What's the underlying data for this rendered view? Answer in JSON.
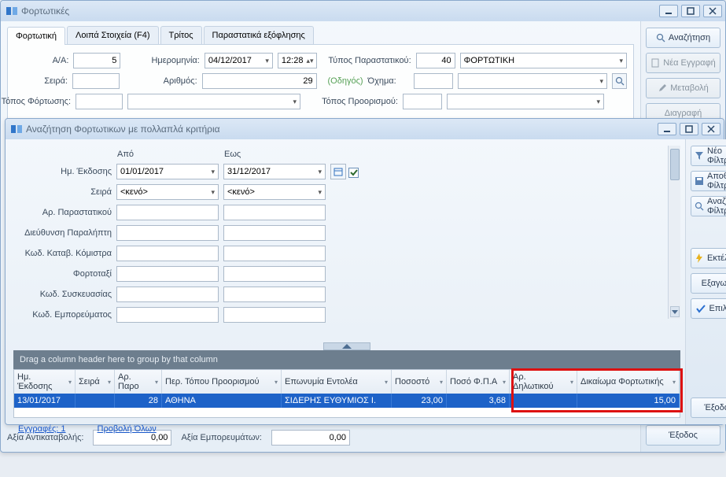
{
  "mainWindow": {
    "title": "Φορτωτικές",
    "tabs": [
      "Φορτωτική",
      "Λοιπά Στοιχεία (F4)",
      "Τρίτος",
      "Παραστατικά εξόφλησης"
    ],
    "form": {
      "aa_label": "A/A:",
      "aa_value": "5",
      "date_label": "Ημερομηνία:",
      "date_value": "04/12/2017",
      "time_value": "12:28",
      "doc_type_label": "Τύπος Παραστατικού:",
      "doc_type_code": "40",
      "doc_type_name": "ΦΟΡΤΩΤΙΚΗ",
      "seira_label": "Σειρά:",
      "seira_value": "",
      "arithmos_label": "Αριθμός:",
      "arithmos_value": "29",
      "odigos_label": "(Οδηγός)",
      "ochima_label": "Όχημα:",
      "ochima_value": "",
      "topos_fort_label": "Τόπος Φόρτωσης:",
      "topos_fort_value": "",
      "topos_proor_label": "Τόπος Προορισμού:",
      "topos_proor_value": ""
    },
    "footer": {
      "antikat_label": "Αξία Αντικαταβολής:",
      "antikat_value": "0,00",
      "emporev_label": "Αξία Εμπορευμάτων:",
      "emporev_value": "0,00"
    },
    "sidebar": {
      "search": "Αναζήτηση",
      "new": "Νέα Εγγραφή",
      "edit": "Μεταβολή",
      "delete": "Διαγραφή",
      "exit": "Έξοδος"
    }
  },
  "searchWindow": {
    "title": "Αναζήτηση Φορτωτικων με πολλαπλά κριτήρια",
    "colheads": {
      "from": "Από",
      "to": "Εως"
    },
    "criteria": {
      "date_label": "Ημ. Έκδοσης",
      "date_from": "01/01/2017",
      "date_to": "31/12/2017",
      "seira_label": "Σειρά",
      "seira_empty": "<κενό>",
      "ar_par_label": "Αρ. Παραστατικού",
      "dieuth_label": "Διεύθυνση Παραλήπτη",
      "kwd_kom_label": "Κωδ. Καταβ. Κόμιστρα",
      "fortotaxi_label": "Φορτοταξί",
      "kwd_sysk_label": "Κωδ. Συσκευασίας",
      "kwd_emp_label": "Κωδ. Εμπορεύματος"
    },
    "sidebar": {
      "newfilter": "Νέο Φίλτρο",
      "savefilter": "Αποθ. Φίλτρου",
      "loadfilter": "Αναζ. Φίλτρου",
      "run": "Εκτέλεση",
      "export": "Εξαγωγή",
      "select": "Επιλογή",
      "exit": "Έξοδος"
    },
    "grid": {
      "group_prompt": "Drag a column header here to group by that column",
      "columns": [
        "Ημ. Έκδοσης",
        "Σειρά",
        "Αρ. Παρο",
        "Περ. Τόπου Προορισμού",
        "Επωνυμία Εντολέα",
        "Ποσοστό",
        "Ποσό Φ.Π.Α",
        "Αρ. Δηλωτικού",
        "Δικαίωμα Φορτωτικής"
      ],
      "row": {
        "date": "13/01/2017",
        "seira": "",
        "arpar": "28",
        "proor": "ΑΘΗΝΑ",
        "entolea": "ΣΙΔΕΡΗΣ ΕΥΘΥΜΙΟΣ Ι.",
        "pososto": "23,00",
        "fpa": "3,68",
        "dilotiko": "",
        "dikaioma": "15,00"
      },
      "footer_records": "Εγγραφές: 1",
      "footer_viewall": "Προβολή Όλων"
    }
  }
}
